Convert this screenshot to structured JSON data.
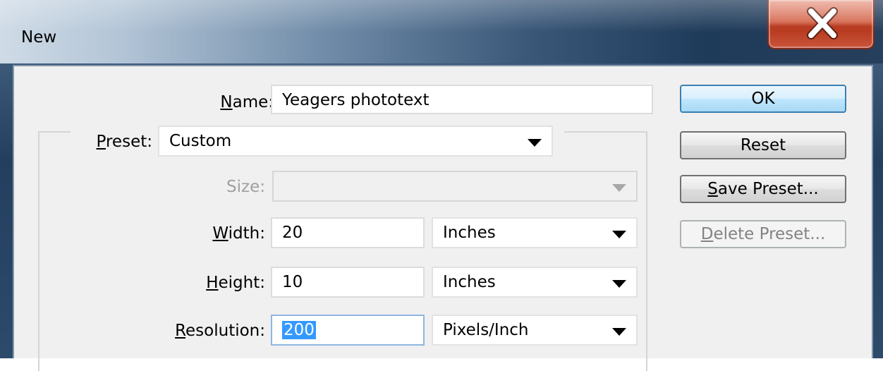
{
  "window": {
    "title": "New"
  },
  "form": {
    "name": {
      "label": "Name:",
      "value": "Yeagers phototext"
    },
    "preset": {
      "label": "Preset:",
      "value": "Custom"
    },
    "size": {
      "label": "Size:",
      "value": ""
    },
    "width": {
      "label": "Width:",
      "value": "20",
      "unit": "Inches"
    },
    "height": {
      "label": "Height:",
      "value": "10",
      "unit": "Inches"
    },
    "resolution": {
      "label": "Resolution:",
      "value": "200",
      "unit": "Pixels/Inch"
    }
  },
  "buttons": {
    "ok": "OK",
    "reset": "Reset",
    "save_preset": "Save Preset...",
    "delete_preset": "Delete Preset..."
  },
  "icons": {
    "close": "close-icon",
    "dropdown": "chevron-down-icon"
  }
}
